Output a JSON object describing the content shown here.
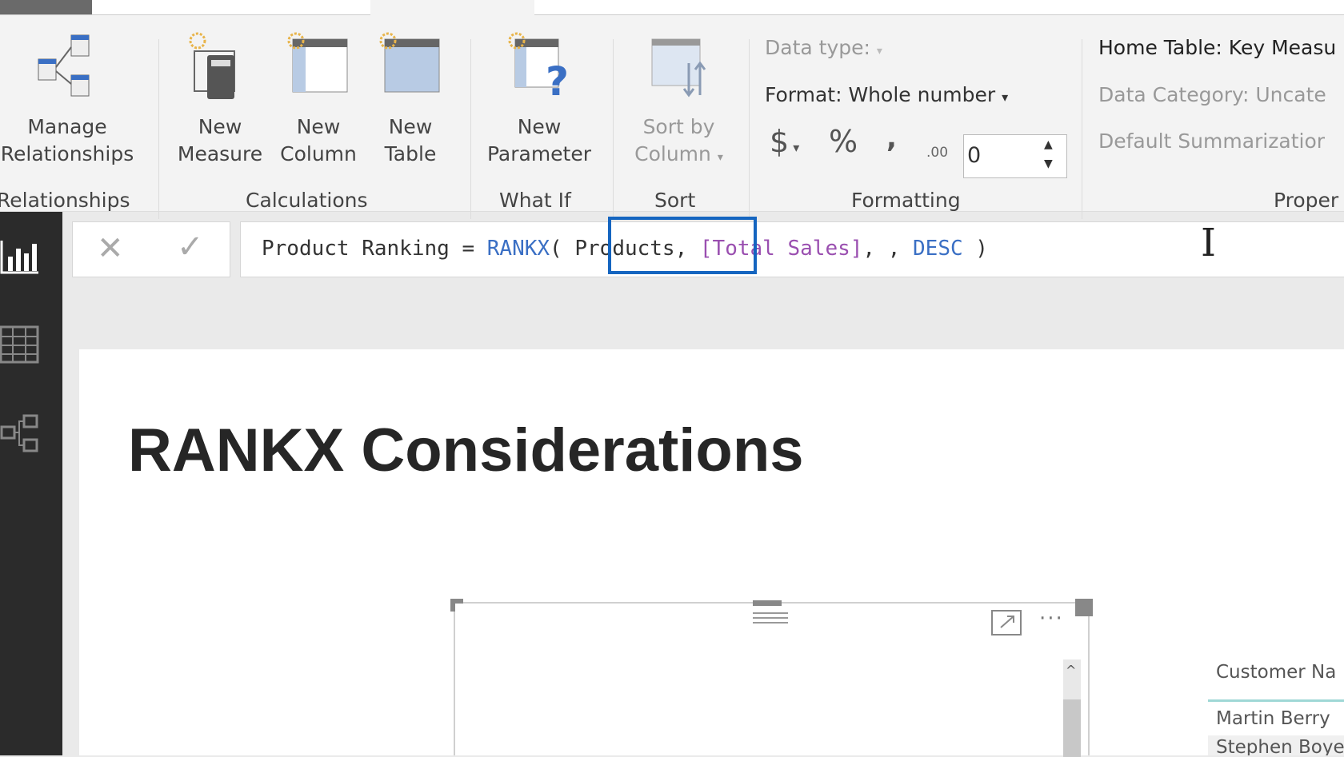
{
  "ribbon": {
    "buttons": [
      {
        "label1": "Manage",
        "label2": "Relationships",
        "icon": "manage-relationships-icon"
      },
      {
        "label1": "New",
        "label2": "Measure",
        "icon": "new-measure-icon"
      },
      {
        "label1": "New",
        "label2": "Column",
        "icon": "new-column-icon"
      },
      {
        "label1": "New",
        "label2": "Table",
        "icon": "new-table-icon"
      },
      {
        "label1": "New",
        "label2": "Parameter",
        "icon": "new-parameter-icon"
      },
      {
        "label1": "Sort by",
        "label2": "Column",
        "icon": "sort-by-column-icon"
      }
    ],
    "groups": {
      "relationships": "Relationships",
      "calculations": "Calculations",
      "whatif": "What If",
      "sort": "Sort",
      "formatting": "Formatting",
      "properties": "Proper"
    },
    "formatting": {
      "data_type": "Data type:",
      "format": "Format: Whole number",
      "currency": "$",
      "percent": "%",
      "comma": ",",
      "decimals_icon": ".00",
      "decimals_value": "0"
    },
    "properties": {
      "home_table": "Home Table: Key Measu",
      "data_category": "Data Category: Uncate",
      "default_summarization": "Default Summarizatior"
    }
  },
  "formula": {
    "cancel": "✕",
    "commit": "✓",
    "p1": "Product Ranking = ",
    "fn": "RANKX",
    "p2": "( ",
    "highlight": "Products,",
    "p3": " ",
    "col": "[Total Sales]",
    "p4": ", , ",
    "desc": "DESC",
    "p5": " )",
    "highlight_color": "#1565c0"
  },
  "canvas": {
    "title": "RANKX Considerations"
  },
  "table": {
    "header": "Customer Na",
    "rows": [
      "Martin Berry",
      "Stephen Boyer"
    ],
    "accent": "#9fd8d6"
  }
}
